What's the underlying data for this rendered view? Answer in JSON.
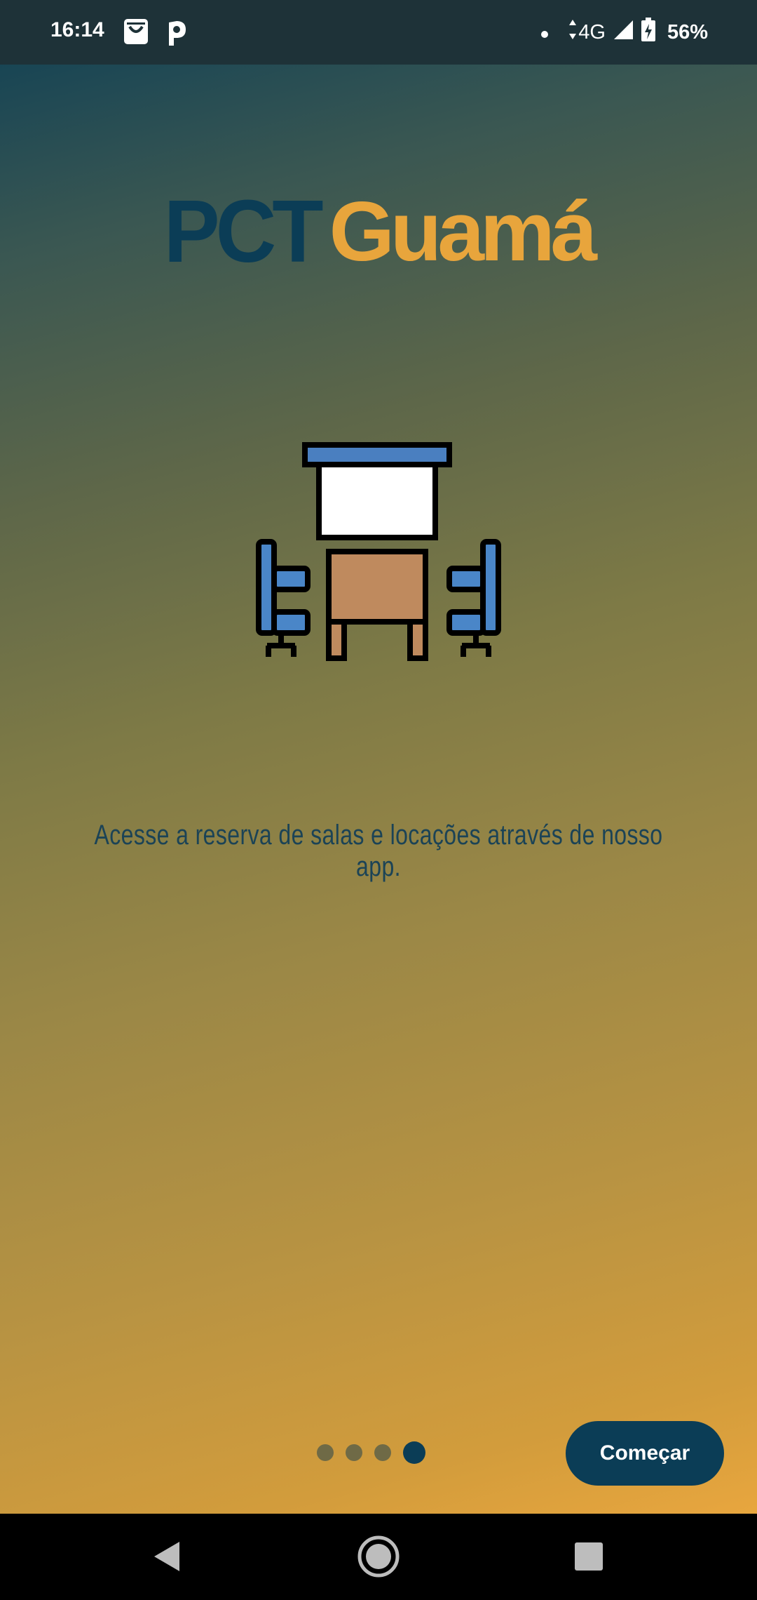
{
  "status_bar": {
    "time": "16:14",
    "network": "4G",
    "battery": "56%",
    "icons": [
      "shopping-bag-icon",
      "parking-icon",
      "notification-dot-icon",
      "data-arrows-icon",
      "signal-icon",
      "battery-charging-icon"
    ]
  },
  "logo": {
    "part1": "PCT",
    "part2": "Guamá",
    "colors": {
      "part1": "#0b3d56",
      "part2": "#e8a53c"
    }
  },
  "illustration": {
    "icon": "meeting-room-icon",
    "colors": {
      "board_frame": "#4a7fc0",
      "chair": "#4a86c8",
      "table": "#bf8a5e",
      "outline": "#000000"
    }
  },
  "onboarding": {
    "caption": "Acesse a reserva de salas e locações através de nosso app.",
    "page_count": 4,
    "current_page": 4
  },
  "actions": {
    "start_label": "Começar"
  },
  "navigation": {
    "icons": [
      "back-icon",
      "home-icon",
      "recents-icon"
    ]
  },
  "theme": {
    "gradient_top": "#0d3f55",
    "gradient_bottom": "#e8a63e",
    "accent": "#0b3d56"
  }
}
